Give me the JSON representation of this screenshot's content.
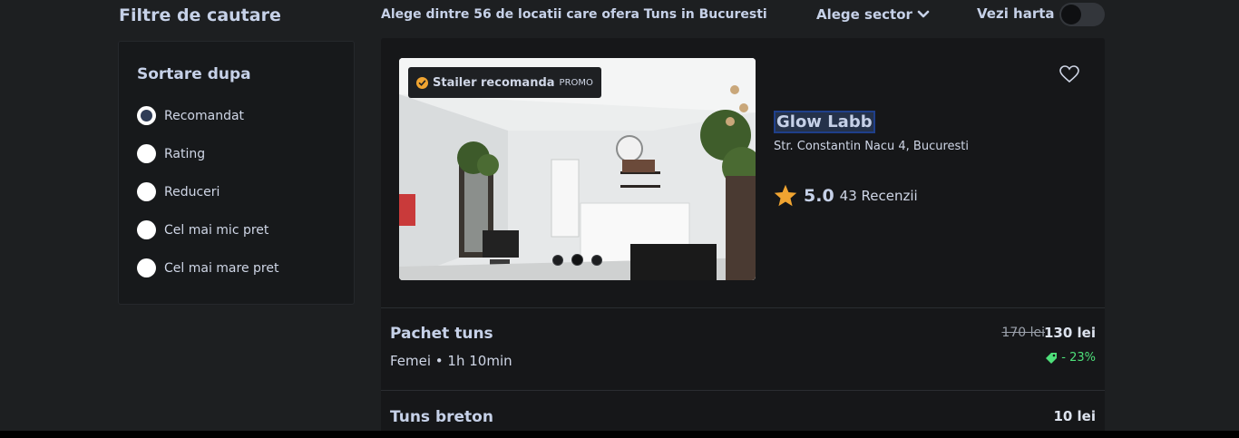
{
  "filters": {
    "title": "Filtre de cautare",
    "sort_title": "Sortare dupa",
    "sort_options": [
      {
        "label": "Recomandat",
        "checked": true
      },
      {
        "label": "Rating",
        "checked": false
      },
      {
        "label": "Reduceri",
        "checked": false
      },
      {
        "label": "Cel mai mic pret",
        "checked": false
      },
      {
        "label": "Cel mai mare pret",
        "checked": false
      }
    ]
  },
  "header": {
    "results_text": "Alege dintre 56 de locatii care ofera Tuns in Bucuresti",
    "sector_label": "Alege sector",
    "map_label": "Vezi harta",
    "map_toggle_on": false
  },
  "salon": {
    "badge_label": "Stailer recomanda",
    "badge_tag": "PROMO",
    "name": "Glow Labb",
    "address": "Str. Constantin Nacu 4, Bucuresti",
    "rating": "5.0",
    "reviews": "43 Recenzii",
    "photo_count": 3,
    "active_photo": 2
  },
  "services": [
    {
      "name": "Pachet tuns",
      "meta": "Femei • 1h 10min",
      "old_price": "170 lei",
      "price": "130 lei",
      "discount": "- 23%"
    },
    {
      "name": "Tuns breton",
      "price": "10 lei"
    }
  ],
  "colors": {
    "accent_star": "#f0a431",
    "discount_green": "#4ee07a",
    "background": "#1d1f21",
    "card": "#161719"
  }
}
